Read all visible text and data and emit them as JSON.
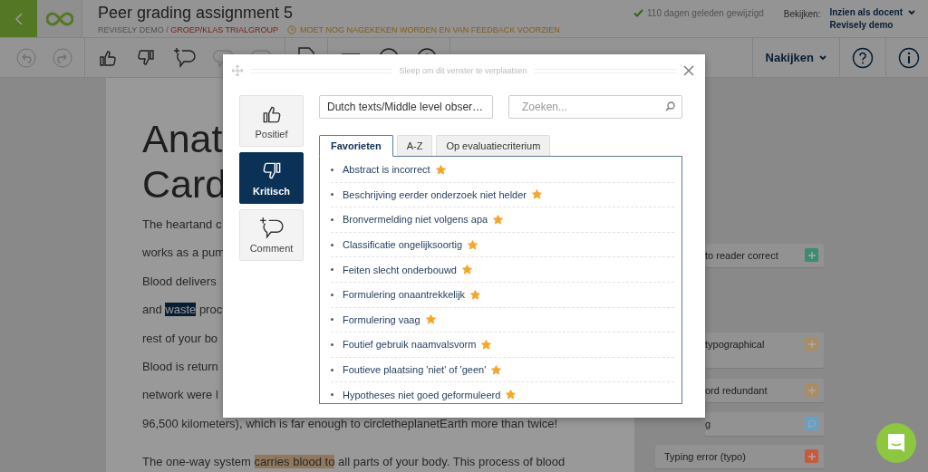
{
  "header": {
    "title": "Peer grading assignment 5",
    "org": "REVISELY DEMO / ",
    "group": "GROEP/KLAS TRIALGROUP",
    "status": "MOET NOG NAGEKEKEN WORDEN EN VAN FEEDBACK VOORZIEN",
    "modified": "110 dagen geleden gewijzigd",
    "view_label": "Bekijken:",
    "view_mode": "Inzien als docent",
    "view_user": "Revisely demo"
  },
  "toolbar": {
    "mode": "Nakijken"
  },
  "document": {
    "title_lines": [
      "Anat",
      "Card"
    ],
    "paragraphs": [
      {
        "lines": [
          {
            "segments": [
              {
                "text": "The heartand c",
                "kind": "plain"
              }
            ]
          },
          {
            "segments": [
              {
                "text": "works as a pum",
                "kind": "plain"
              }
            ]
          },
          {
            "segments": [
              {
                "text": "Blood delivers",
                "kind": "plain"
              }
            ]
          },
          {
            "segments": [
              {
                "text": "and ",
                "kind": "plain"
              },
              {
                "text": "waste",
                "kind": "selected"
              },
              {
                "text": " proc",
                "kind": "plain"
              }
            ]
          },
          {
            "segments": [
              {
                "text": "rest of your bo",
                "kind": "plain"
              }
            ]
          },
          {
            "segments": [
              {
                "text": "Blood is return",
                "kind": "plain"
              }
            ]
          },
          {
            "segments": [
              {
                "text": "network were l",
                "kind": "plain"
              }
            ]
          },
          {
            "segments": [
              {
                "text": "96,500 kilometers), which is far enough to circletheplanetEarth more than twice!",
                "kind": "plain"
              }
            ]
          }
        ]
      },
      {
        "lines": [
          {
            "segments": [
              {
                "text": "The one-way system ",
                "kind": "plain"
              },
              {
                "text": "carries blood to",
                "kind": "highlight"
              },
              {
                "text": " all parts of your body. This process of blood",
                "kind": "plain"
              }
            ]
          }
        ]
      }
    ]
  },
  "annotations": [
    {
      "text": "to reader correct",
      "kind": "add",
      "color": "#3c8c6e"
    },
    {
      "text": "typographical",
      "kind": "add",
      "color": "#aa8c64"
    },
    {
      "text": "ord redundant",
      "kind": "add",
      "color": "#aa8c64"
    },
    {
      "text": "g",
      "kind": "comment",
      "color": "#64a0c8"
    },
    {
      "text": "Typing error (typo)",
      "kind": "add",
      "color": "#c85a3c"
    }
  ],
  "dialog": {
    "drag_hint": "Sleep om dit venster te verplaatsen",
    "types": [
      {
        "label": "Positief",
        "kind": "positive",
        "selected": false
      },
      {
        "label": "Kritisch",
        "kind": "critical",
        "selected": true
      },
      {
        "label": "Comment",
        "kind": "comment",
        "selected": false
      }
    ],
    "set_select": "Dutch texts/Middle level obser…",
    "search": {
      "placeholder": "Zoeken..."
    },
    "tabs": [
      {
        "label": "Favorieten",
        "selected": true
      },
      {
        "label": "A-Z",
        "selected": false
      },
      {
        "label": "Op evaluatiecriterium",
        "selected": false
      }
    ],
    "items": [
      {
        "text": "Abstract is incorrect",
        "favorite": true
      },
      {
        "text": "Beschrijving eerder onderzoek niet helder",
        "favorite": true
      },
      {
        "text": "Bronvermelding niet volgens apa",
        "favorite": true
      },
      {
        "text": "Classificatie ongelijksoortig",
        "favorite": true
      },
      {
        "text": "Feiten slecht onderbouwd",
        "favorite": true
      },
      {
        "text": "Formulering onaantrekkelijk",
        "favorite": true
      },
      {
        "text": "Formulering vaag",
        "favorite": true
      },
      {
        "text": "Foutief gebruik naamvalsvorm",
        "favorite": true
      },
      {
        "text": "Foutieve plaatsing 'niet' of 'geen'",
        "favorite": true
      },
      {
        "text": "Hypotheses niet goed geformuleerd",
        "favorite": true
      }
    ]
  }
}
